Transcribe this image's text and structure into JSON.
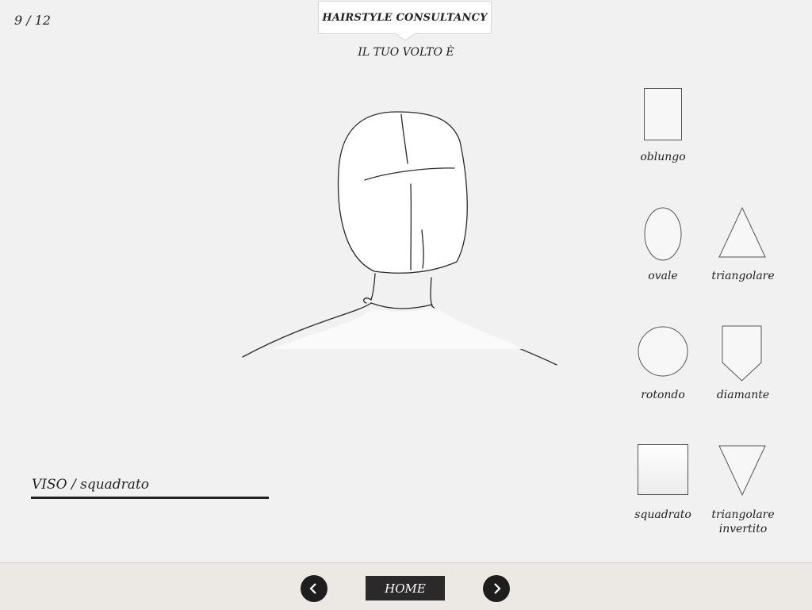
{
  "header": {
    "page_counter": "9 / 12",
    "title": "HAIRSTYLE CONSULTANCY",
    "subtitle": "IL TUO VOLTO È"
  },
  "shapes": [
    {
      "id": "oblungo",
      "label": "oblungo",
      "icon": "rectangle-tall-icon"
    },
    {
      "id": "ovale",
      "label": "ovale",
      "icon": "oval-icon"
    },
    {
      "id": "triangolare",
      "label": "triangolare",
      "icon": "triangle-icon"
    },
    {
      "id": "rotondo",
      "label": "rotondo",
      "icon": "circle-icon"
    },
    {
      "id": "diamante",
      "label": "diamante",
      "icon": "shield-pentagon-icon"
    },
    {
      "id": "squadrato",
      "label": "squadrato",
      "icon": "square-icon",
      "selected": true
    },
    {
      "id": "triangolare-invertito",
      "label_line1": "triangolare",
      "label_line2": "invertito",
      "icon": "inverted-triangle-icon"
    }
  ],
  "result": {
    "text": "VISO / squadrato"
  },
  "footer": {
    "prev_icon": "chevron-left-icon",
    "home_label": "HOME",
    "next_icon": "chevron-right-icon"
  },
  "colors": {
    "background": "#f1f1f1",
    "footer_background": "#ece9e4",
    "button_dark": "#1e1e1e",
    "line": "#555555"
  }
}
